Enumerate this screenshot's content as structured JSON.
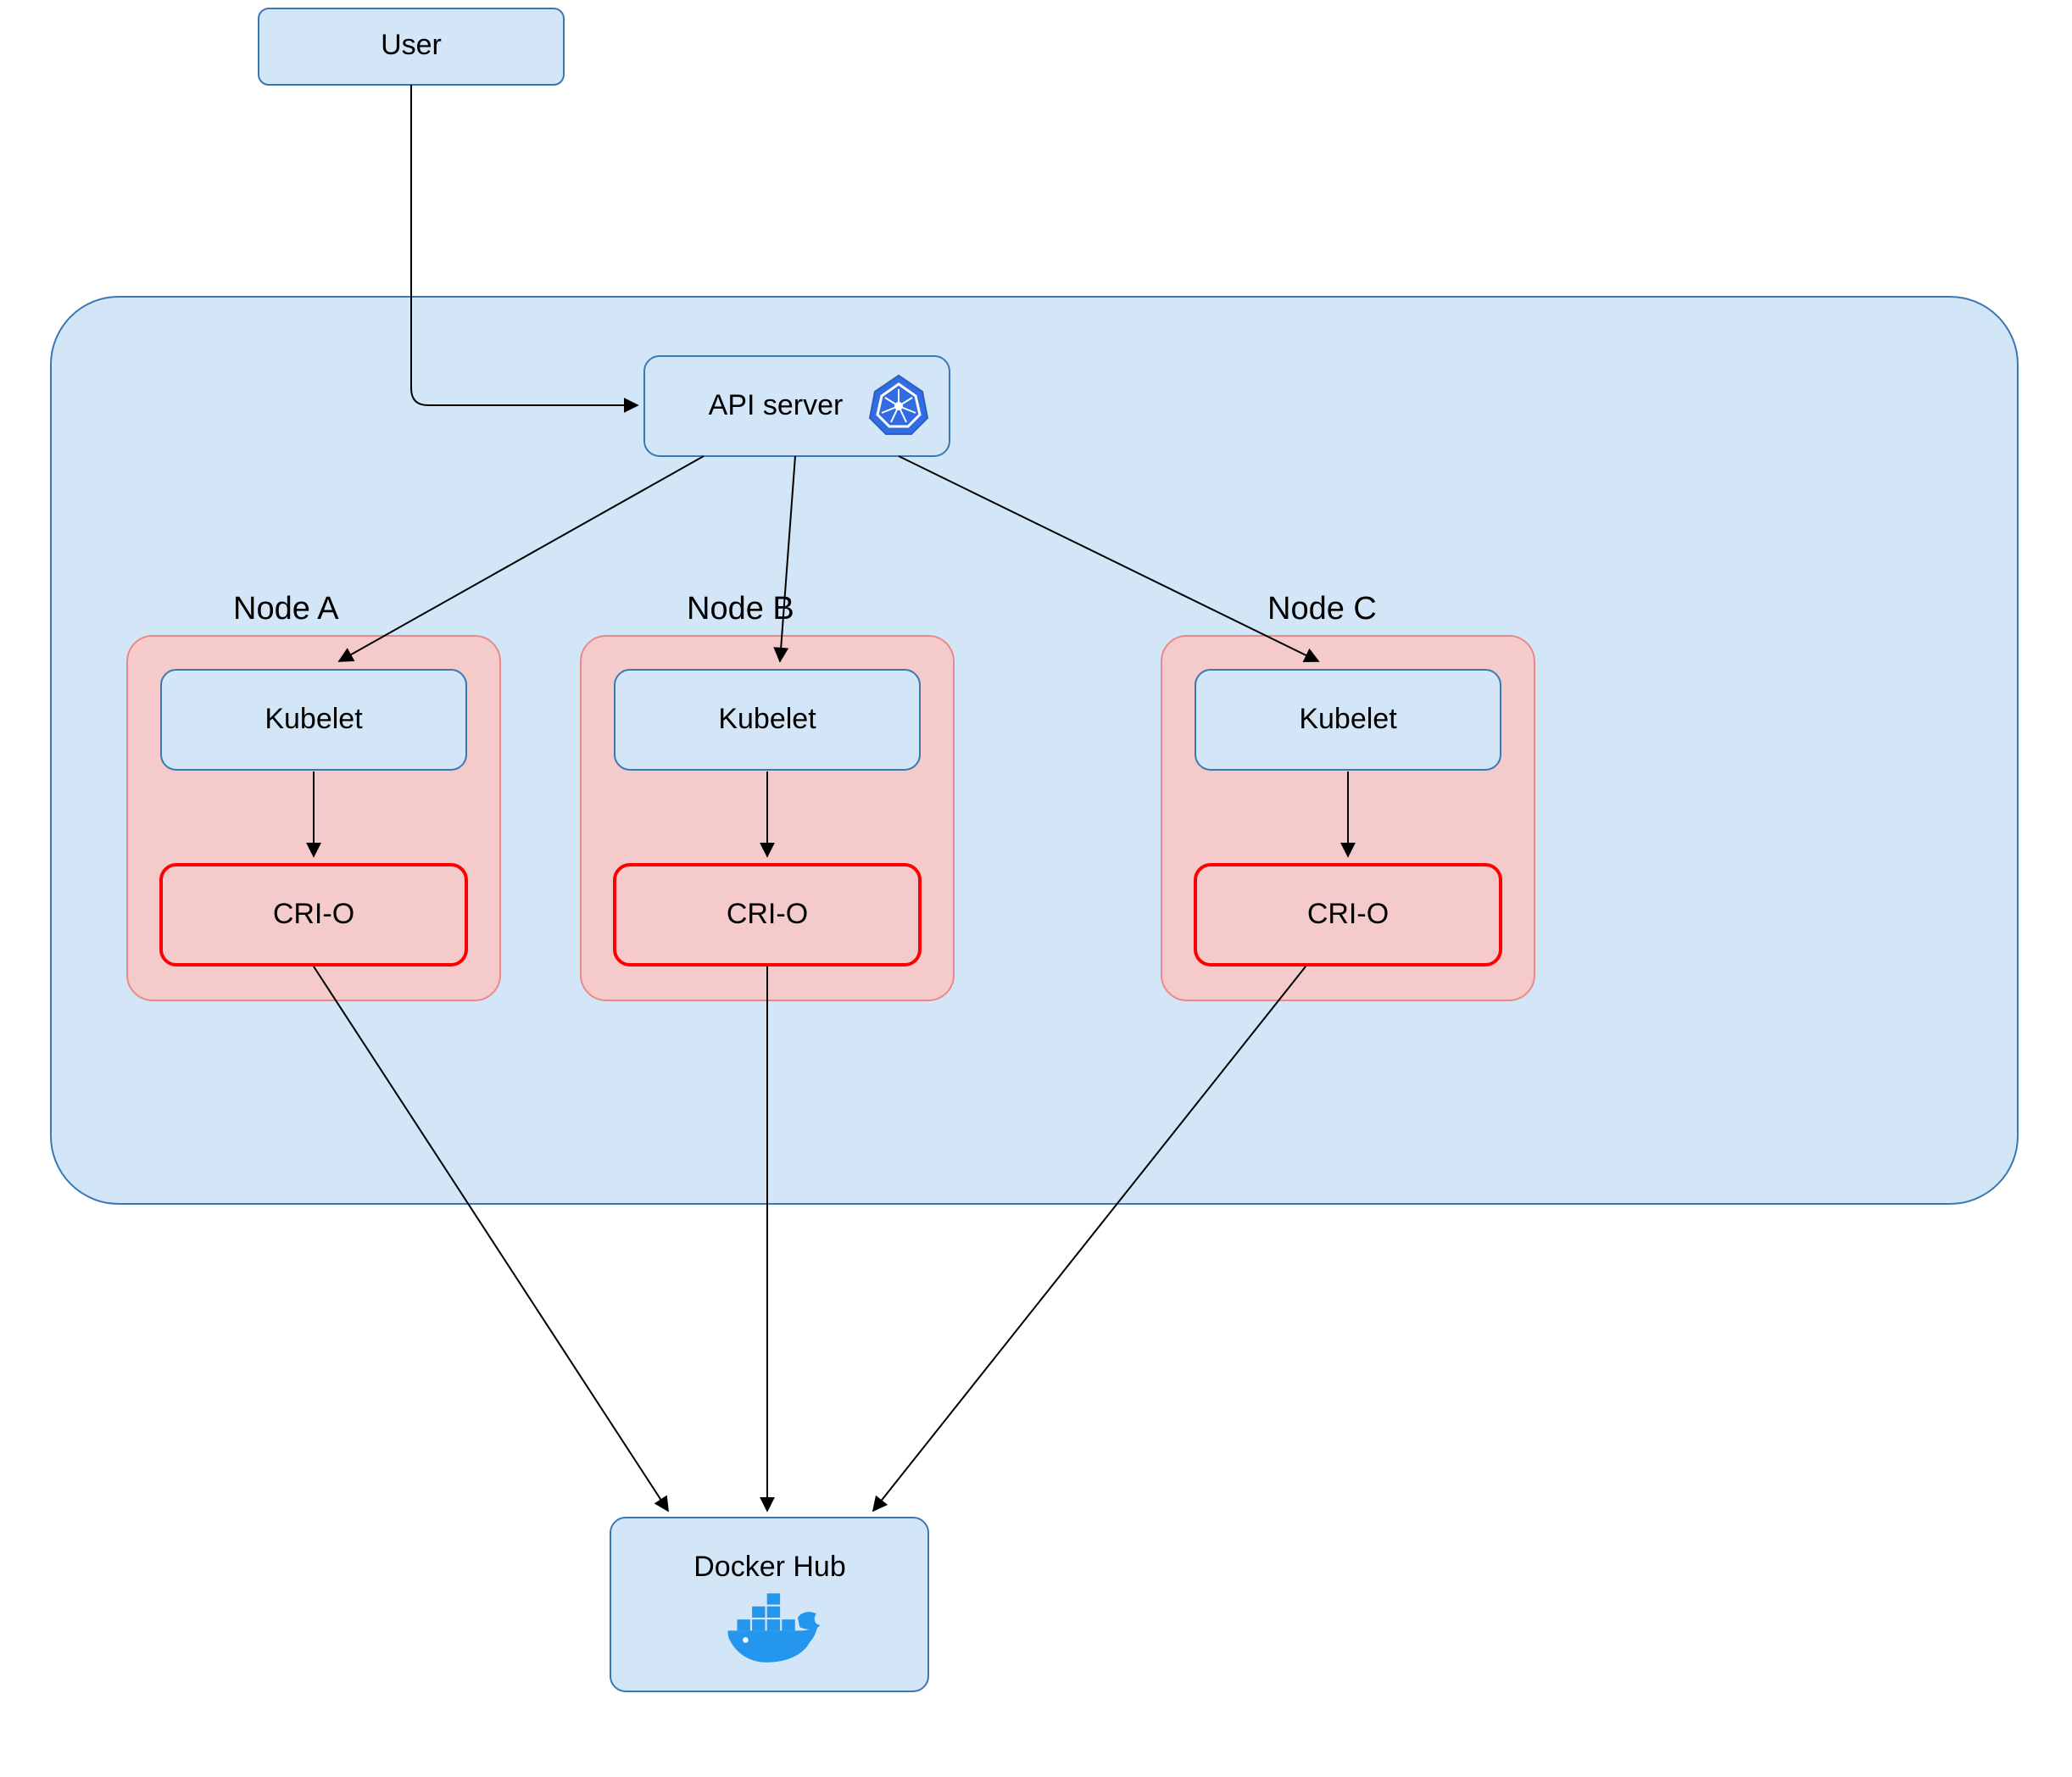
{
  "colors": {
    "blue_fill": "#d3e6f8",
    "blue_stroke": "#3a78b3",
    "pink_fill": "#f4caca",
    "pink_stroke": "#e98a8a",
    "red_stroke": "#ff0000",
    "docker_blue": "#2496ed"
  },
  "user": {
    "label": "User"
  },
  "api_server": {
    "label": "API server"
  },
  "nodes": [
    {
      "title": "Node A",
      "kubelet": "Kubelet",
      "crio": "CRI-O"
    },
    {
      "title": "Node B",
      "kubelet": "Kubelet",
      "crio": "CRI-O"
    },
    {
      "title": "Node C",
      "kubelet": "Kubelet",
      "crio": "CRI-O"
    }
  ],
  "docker_hub": {
    "label": "Docker Hub"
  }
}
